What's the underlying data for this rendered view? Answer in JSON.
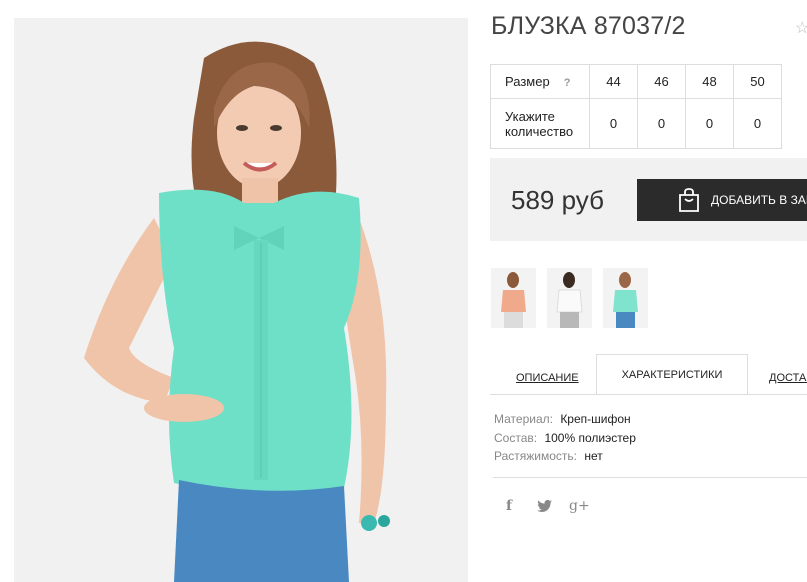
{
  "product": {
    "title": "БЛУЗКА 87037/2",
    "wishlist_icon": "star-outline-icon"
  },
  "size_table": {
    "size_label": "Размер",
    "help_icon": "?",
    "sizes": [
      "44",
      "46",
      "48",
      "50"
    ],
    "quantity_label_line1": "Укажите",
    "quantity_label_line2": "количество",
    "quantities": [
      "0",
      "0",
      "0",
      "0"
    ]
  },
  "buy_box": {
    "price": "589 руб",
    "cart_button_label": "ДОБАВИТЬ В ЗАКАЗ",
    "cart_icon": "shopping-bag-icon"
  },
  "thumbnails": [
    {
      "description": "peach-blouse-thumbnail",
      "color": "#f0a98a"
    },
    {
      "description": "white-blouse-thumbnail",
      "color": "#fafafa"
    },
    {
      "description": "mint-blouse-thumbnail",
      "color": "#7fe3cd"
    }
  ],
  "tabs": [
    "ОПИСАНИЕ",
    "ХАРАКТЕРИСТИКИ",
    "ДОСТАВКА"
  ],
  "active_tab": "ХАРАКТЕРИСТИКИ",
  "specs": [
    {
      "key": "Материал:",
      "value": "Креп-шифон"
    },
    {
      "key": "Состав:",
      "value": "100% полиэстер"
    },
    {
      "key": "Растяжимость:",
      "value": "нет"
    }
  ],
  "social": {
    "facebook": "f",
    "twitter_icon": "twitter-bird-icon",
    "google_plus": "g+"
  },
  "colors": {
    "blouse": "#6fe0c8",
    "dark_button": "#2b2b2b",
    "panel_bg": "#f1f1f1"
  }
}
